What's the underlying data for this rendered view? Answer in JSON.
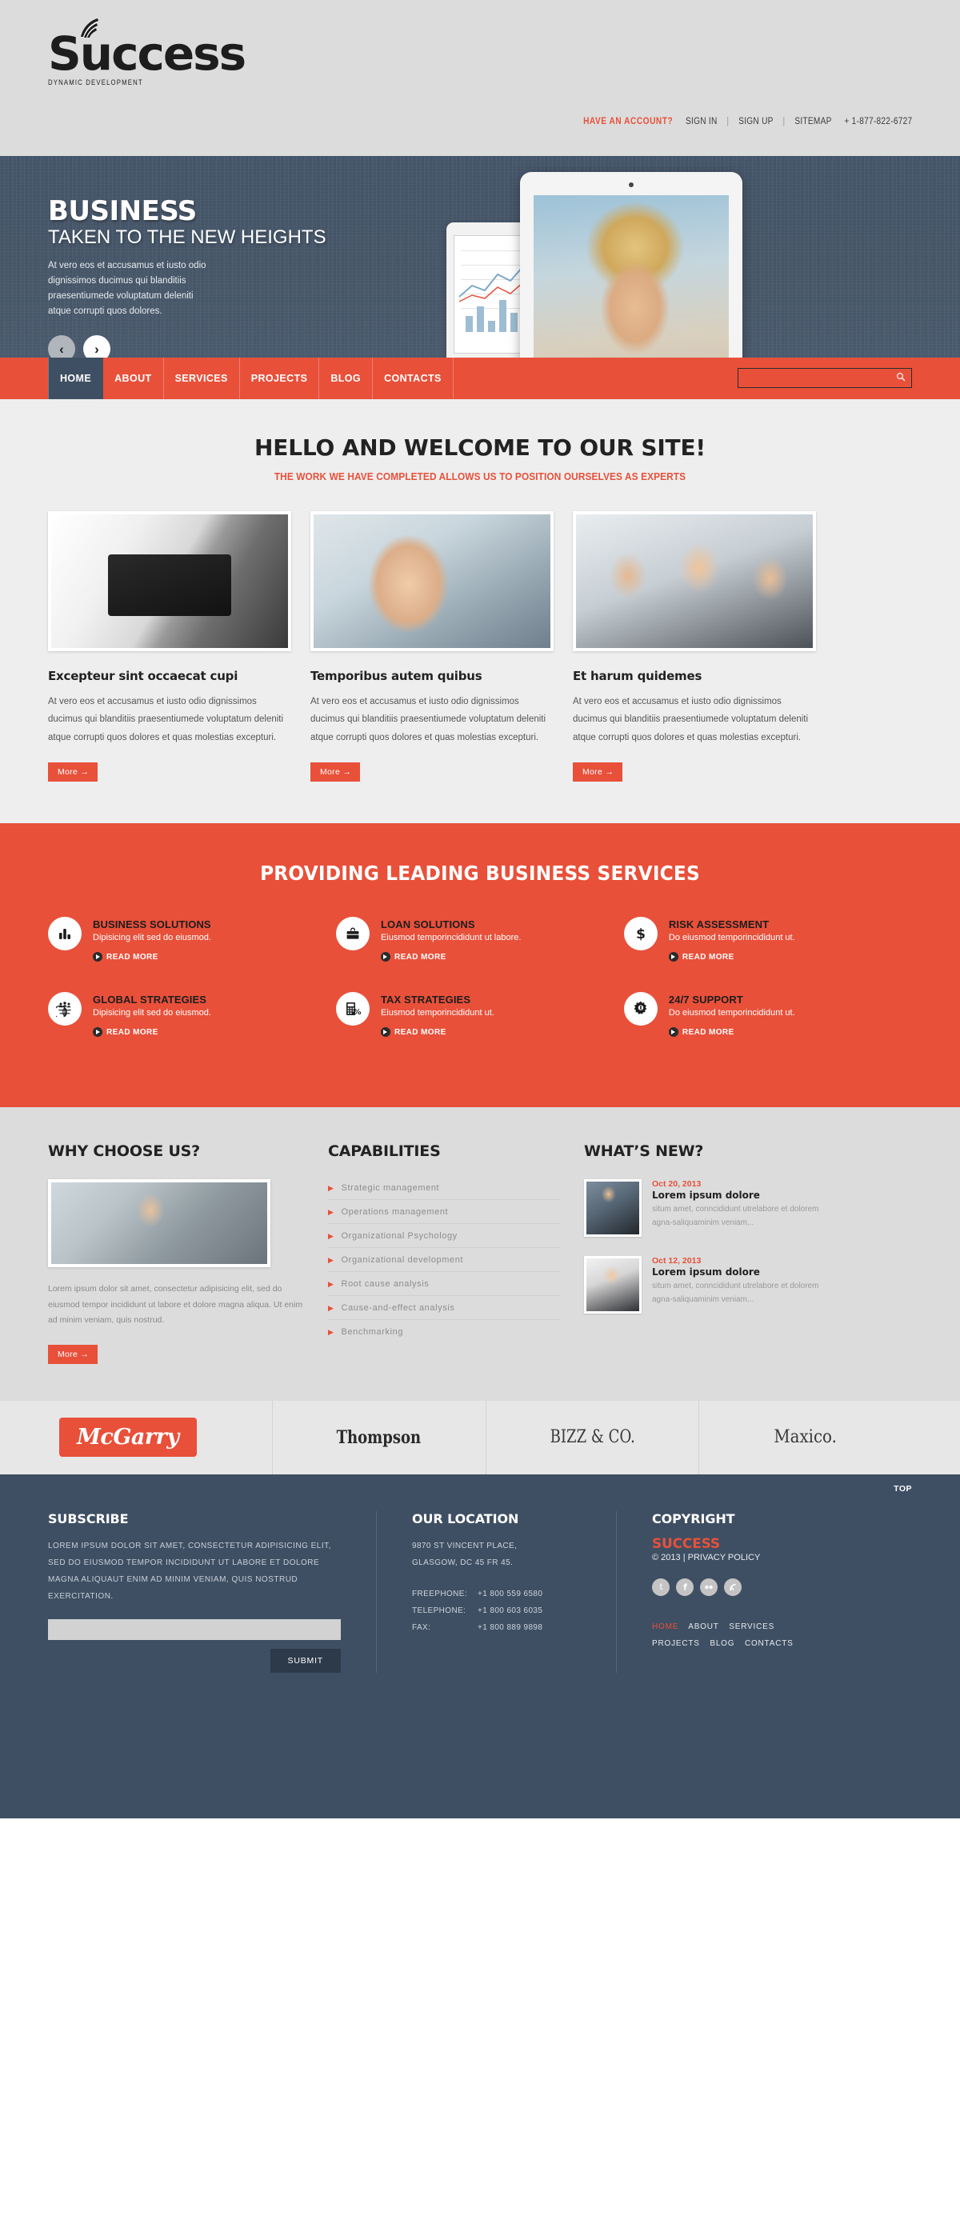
{
  "header": {
    "logo_main": "Success",
    "logo_sub": "DYNAMIC DEVELOPMENT",
    "topnav": {
      "prompt": "HAVE AN ACCOUNT?",
      "sign_in": "SIGN IN",
      "sign_up": "SIGN UP",
      "sitemap": "SITEMAP",
      "phone": "+ 1-877-822-6727",
      "sep": "|"
    }
  },
  "hero": {
    "title": "BUSINESS",
    "subtitle": "TAKEN TO THE NEW HEIGHTS",
    "paragraph": "At vero eos et accusamus et iusto odio dignissimos ducimus qui blanditiis praesentiumede voluptatum deleniti atque corrupti quos dolores.",
    "prev": "‹",
    "next": "›"
  },
  "nav": {
    "items": [
      {
        "label": "HOME",
        "active": true
      },
      {
        "label": "ABOUT",
        "active": false
      },
      {
        "label": "SERVICES",
        "active": false
      },
      {
        "label": "PROJECTS",
        "active": false
      },
      {
        "label": "BLOG",
        "active": false
      },
      {
        "label": "CONTACTS",
        "active": false
      }
    ],
    "search_placeholder": ""
  },
  "welcome": {
    "title": "HELLO AND WELCOME TO OUR SITE!",
    "subtitle": "THE WORK WE HAVE COMPLETED ALLOWS US TO POSITION OURSELVES AS EXPERTS",
    "cards": [
      {
        "title": "Excepteur sint occaecat cupi",
        "body": "At vero eos et accusamus et iusto odio dignissimos ducimus qui blanditiis praesentiumede voluptatum deleniti atque corrupti quos dolores et quas molestias excepturi.",
        "button": "More →"
      },
      {
        "title": "Temporibus autem quibus",
        "body": "At vero eos et accusamus et iusto odio dignissimos ducimus qui blanditiis praesentiumede voluptatum deleniti atque corrupti quos dolores et quas molestias excepturi.",
        "button": "More →"
      },
      {
        "title": "Et harum quidemes",
        "body": "At vero eos et accusamus et iusto odio dignissimos ducimus qui blanditiis praesentiumede voluptatum deleniti atque corrupti quos dolores et quas molestias excepturi.",
        "button": "More →"
      }
    ]
  },
  "services": {
    "title": "PROVIDING LEADING BUSINESS SERVICES",
    "read_more": "READ MORE",
    "items": [
      {
        "icon": "bar-chart-icon",
        "title": "BUSINESS SOLUTIONS",
        "desc": "Dipisicing elit sed do eiusmod."
      },
      {
        "icon": "briefcase-icon",
        "title": "LOAN SOLUTIONS",
        "desc": "Eiusmod temporincididunt ut labore."
      },
      {
        "icon": "dollar-icon",
        "title": "RISK ASSESSMENT",
        "desc": "Do eiusmod temporincididunt ut."
      },
      {
        "icon": "globe-people-icon",
        "title": "GLOBAL STRATEGIES",
        "desc": "Dipisicing elit sed do eiusmod."
      },
      {
        "icon": "calculator-percent-icon",
        "title": "TAX STRATEGIES",
        "desc": "Eiusmod temporincididunt ut."
      },
      {
        "icon": "gear-icon",
        "title": "24/7 SUPPORT",
        "desc": "Do eiusmod temporincididunt ut."
      }
    ]
  },
  "three": {
    "why": {
      "title": "WHY CHOOSE US?",
      "body": "Lorem ipsum dolor sit amet, consectetur adipisicing elit, sed do eiusmod tempor incididunt ut labore et dolore magna aliqua. Ut enim ad minim veniam, quis nostrud.",
      "button": "More →"
    },
    "capabilities": {
      "title": "CAPABILITIES",
      "items": [
        "Strategic management",
        "Operations management",
        "Organizational Psychology",
        "Organizational development",
        "Root cause analysis",
        "Cause-and-effect analysis",
        "Benchmarking"
      ]
    },
    "whatsnew": {
      "title": "WHAT’S NEW?",
      "items": [
        {
          "date": "Oct 20, 2013",
          "title": "Lorem ipsum dolore",
          "body": "situm amet, conncididunt utrelabore et dolorem agna-saliquaminim veniam..."
        },
        {
          "date": "Oct 12, 2013",
          "title": "Lorem ipsum dolore",
          "body": "situm amet, conncididunt utrelabore et dolorem agna-saliquaminim veniam..."
        }
      ]
    }
  },
  "partners": [
    {
      "name": "McGarry",
      "style": "badge"
    },
    {
      "name": "Thompson",
      "style": "serif-bold"
    },
    {
      "name": "BIZZ & CO.",
      "style": "serif"
    },
    {
      "name": "Maxico.",
      "style": "serif"
    }
  ],
  "footer": {
    "top_link": "TOP",
    "subscribe": {
      "title": "SUBSCRIBE",
      "body": "LOREM IPSUM DOLOR SIT AMET, CONSECTETUR ADIPISICING ELIT, SED DO EIUSMOD TEMPOR INCIDIDUNT UT LABORE ET DOLORE MAGNA ALIQUAUT ENIM AD MINIM VENIAM, QUIS NOSTRUD EXERCITATION.",
      "input_value": "",
      "input_placeholder": "",
      "submit": "SUBMIT"
    },
    "location": {
      "title": "OUR LOCATION",
      "address_line1": "9870 ST VINCENT PLACE,",
      "address_line2": "GLASGOW, DC 45 FR 45.",
      "contacts": [
        {
          "label": "FREEPHONE:",
          "value": "+1 800 559 6580"
        },
        {
          "label": "TELEPHONE:",
          "value": "+1 800 603 6035"
        },
        {
          "label": "FAX:",
          "value": "+1 800 889 9898"
        }
      ]
    },
    "copyright": {
      "title": "COPYRIGHT",
      "brand": "SUCCESS",
      "line": "© 2013 | PRIVACY POLICY",
      "socials": [
        "twitter-icon",
        "facebook-icon",
        "flickr-icon",
        "rss-icon"
      ],
      "nav": [
        "HOME",
        "ABOUT",
        "SERVICES",
        "PROJECTS",
        "BLOG",
        "CONTACTS"
      ]
    }
  }
}
